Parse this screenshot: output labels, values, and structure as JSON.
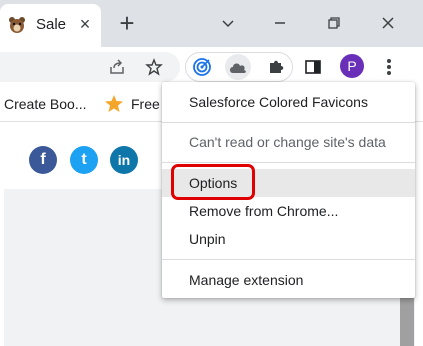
{
  "tab": {
    "title": "Sales",
    "favicon": "salesforce-bear-icon",
    "close_label": "×"
  },
  "tabstrip": {
    "new_tab_label": "+"
  },
  "toolbar": {
    "profile_initial": "P"
  },
  "bookmarks": [
    {
      "label": "Create Boo..."
    },
    {
      "label": "Free",
      "icon": "star-icon"
    }
  ],
  "social": [
    {
      "name": "facebook",
      "glyph": "f",
      "color": "#3b5998"
    },
    {
      "name": "twitter",
      "glyph": "t",
      "color": "#1da1f2"
    },
    {
      "name": "linkedin",
      "glyph": "in",
      "color": "#0e76a8"
    }
  ],
  "menu": {
    "extension_name": "Salesforce Colored Favicons",
    "site_access": "Can't read or change site's data",
    "options": "Options",
    "remove": "Remove from Chrome...",
    "unpin": "Unpin",
    "manage": "Manage extension"
  },
  "colors": {
    "highlight": "#e00000",
    "avatar": "#6a2fb8",
    "tabstrip": "#dee1e6"
  }
}
